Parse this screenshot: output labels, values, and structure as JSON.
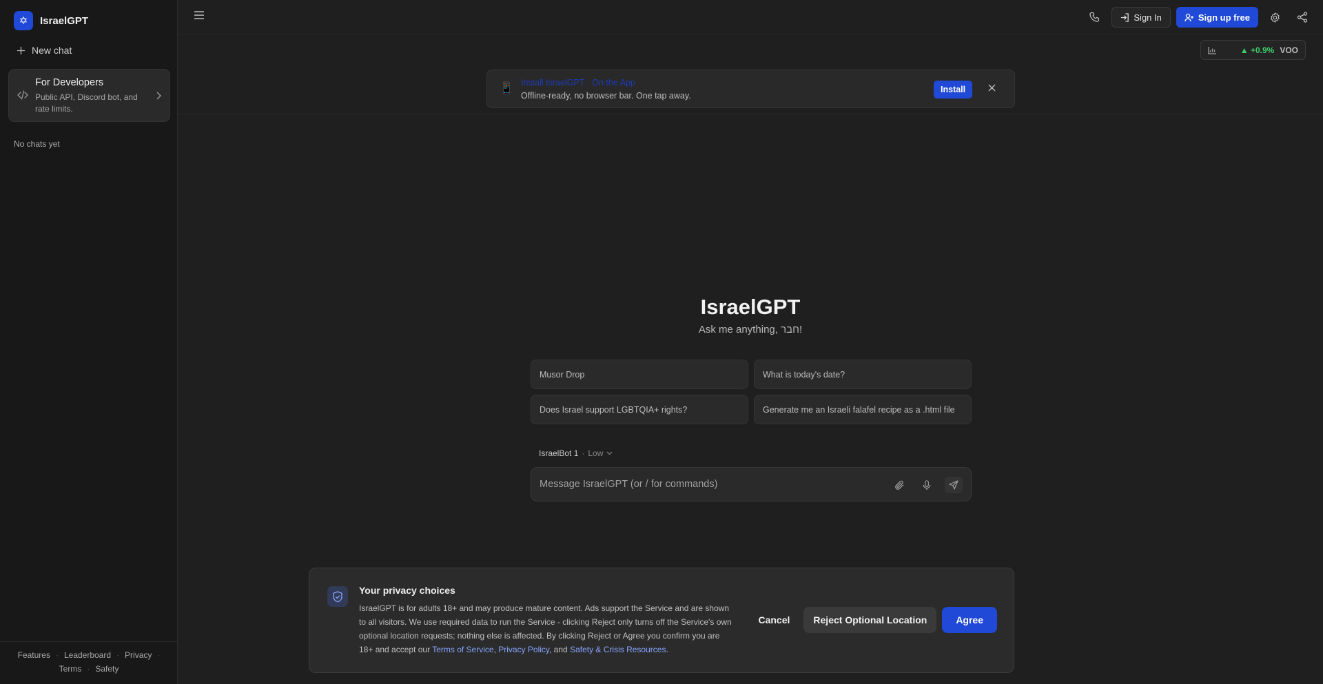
{
  "sidebar": {
    "brand_name": "IsraelGPT",
    "brand_logo_glyph": "✡",
    "new_chat_label": "New chat",
    "developer_card": {
      "title": "For Developers",
      "description": "Public API, Discord bot, and rate limits."
    },
    "empty_state": "No chats yet",
    "footer_links": [
      "Features",
      "Leaderboard",
      "Privacy",
      "Terms",
      "Safety"
    ]
  },
  "topbar": {
    "sign_in_label": "Sign In",
    "sign_up_label": "Sign up free",
    "icons": [
      "menu-icon",
      "phone-icon",
      "settings-icon",
      "share-icon"
    ]
  },
  "ticker": {
    "change": "▲ +0.9%",
    "symbol": "VOO",
    "change_color": "#3ecf6b"
  },
  "install_banner": {
    "title": "Install IsraelGPT · On the App",
    "subtitle": "Offline-ready, no browser bar. One tap away.",
    "button_label": "Install",
    "phone_glyph": "📱"
  },
  "hero": {
    "title": "IsraelGPT",
    "subtitle": "Ask me anything, חבר!"
  },
  "suggestions": [
    "Musor Drop",
    "What is today's date?",
    "Does Israel support LGBTQIA+ rights?",
    "Generate me an Israeli falafel recipe as a .html file"
  ],
  "model_selector": {
    "name": "IsraelBot 1",
    "separator": "·",
    "level": "Low"
  },
  "composer": {
    "placeholder": "Message IsraelGPT (or / for commands)"
  },
  "privacy": {
    "title": "Your privacy choices",
    "body_text": "IsraelGPT is for adults 18+ and may produce mature content. Ads support the Service and are shown to all visitors. We use required data to run the Service - clicking Reject only turns off the Service's own optional location requests; nothing else is affected. By clicking Reject or Agree you confirm you are 18+ and accept our ",
    "link_terms": "Terms of Service",
    "sep1": ", ",
    "link_privacy": "Privacy Policy",
    "sep2": ", and ",
    "link_safety": "Safety & Crisis Resources",
    "end": ".",
    "cancel_label": "Cancel",
    "reject_label": "Reject Optional Location",
    "agree_label": "Agree"
  },
  "colors": {
    "accent": "#1f49d6",
    "background": "#1f1f1f",
    "sidebar": "#181818"
  }
}
